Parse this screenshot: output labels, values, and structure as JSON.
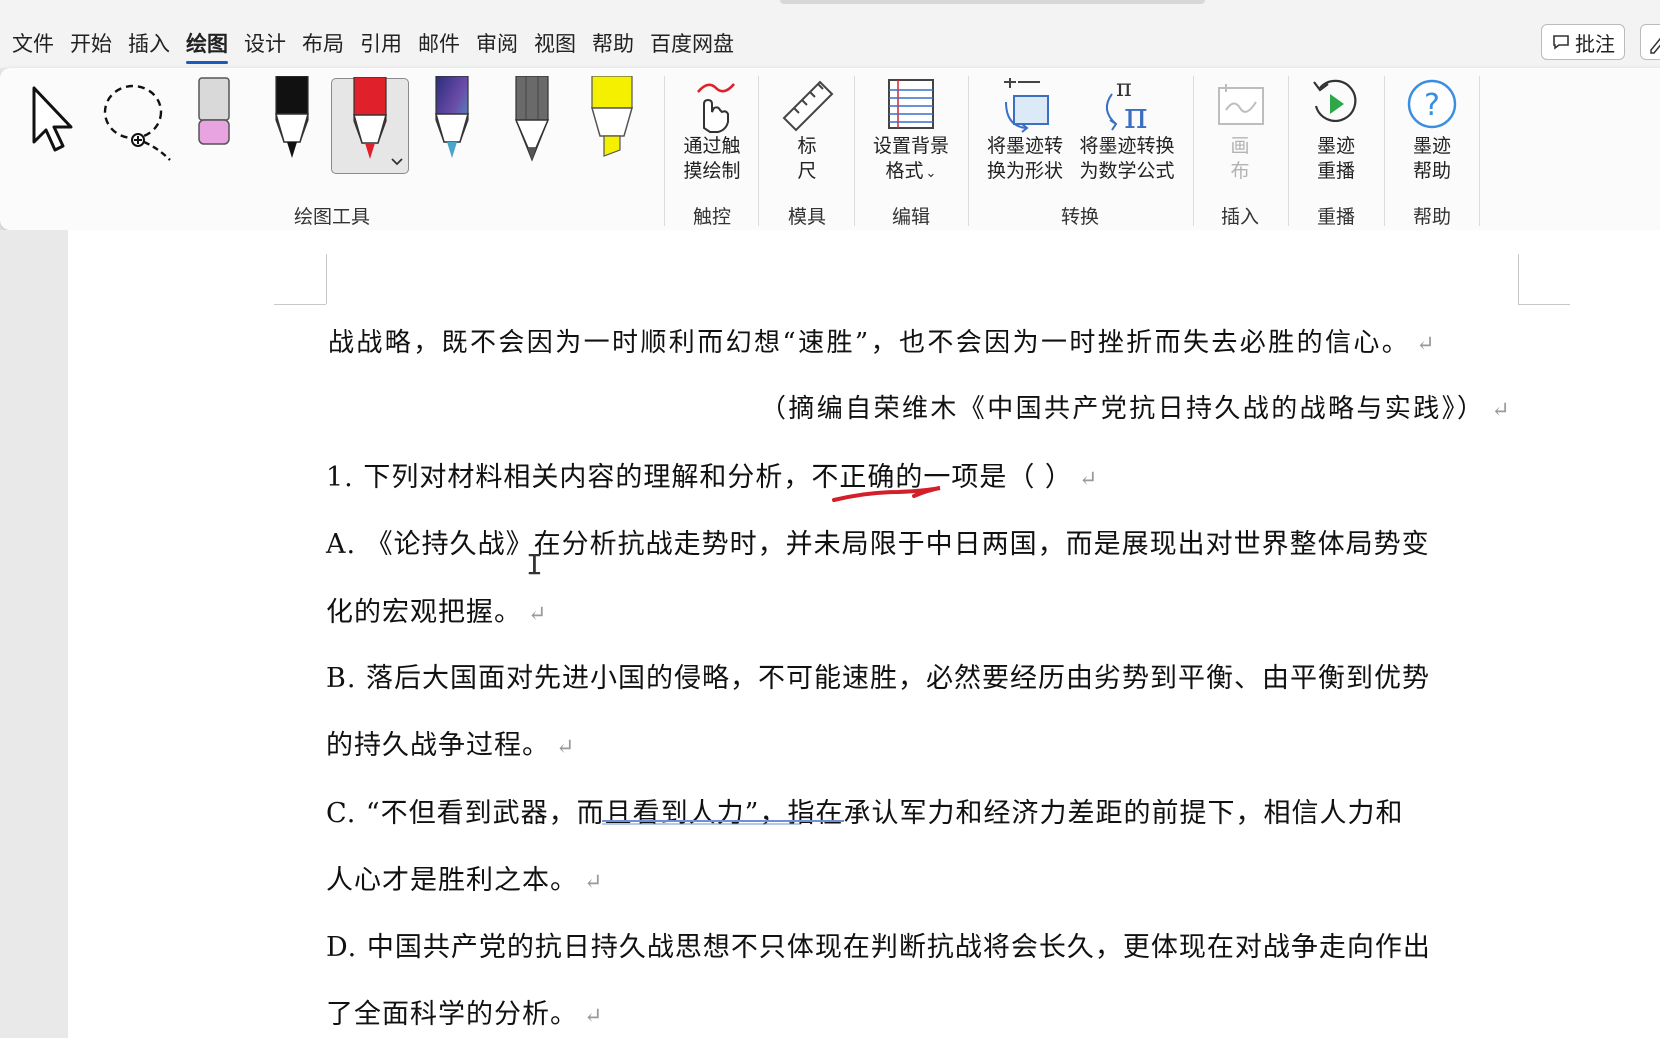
{
  "tabs": [
    {
      "label": "文件",
      "active": false
    },
    {
      "label": "开始",
      "active": false
    },
    {
      "label": "插入",
      "active": false
    },
    {
      "label": "绘图",
      "active": true
    },
    {
      "label": "设计",
      "active": false
    },
    {
      "label": "布局",
      "active": false
    },
    {
      "label": "引用",
      "active": false
    },
    {
      "label": "邮件",
      "active": false
    },
    {
      "label": "审阅",
      "active": false
    },
    {
      "label": "视图",
      "active": false
    },
    {
      "label": "帮助",
      "active": false
    },
    {
      "label": "百度网盘",
      "active": false
    }
  ],
  "comment_button": {
    "label": "批注",
    "icon": "comment-icon"
  },
  "ribbon": {
    "groups": {
      "drawing_tools": "绘图工具",
      "touch": "触控",
      "stencils": "模具",
      "edit": "编辑",
      "convert": "转换",
      "insert": "插入",
      "replay": "重播",
      "help": "帮助"
    },
    "buttons": {
      "draw_with_touch": [
        "通过触",
        "摸绘制"
      ],
      "ruler": [
        "标",
        "尺"
      ],
      "background_format": [
        "设置背景",
        "格式"
      ],
      "ink_to_shape": [
        "将墨迹转",
        "换为形状"
      ],
      "ink_to_math": [
        "将墨迹转换",
        "为数学公式"
      ],
      "canvas": [
        "画",
        "布"
      ],
      "ink_replay": [
        "墨迹",
        "重播"
      ],
      "ink_help": [
        "墨迹",
        "帮助"
      ]
    },
    "pen_colors": {
      "eraser": "#e8a4e0",
      "black_pen": "#111111",
      "red_pen": "#e0202a",
      "galaxy_pen": "#4aa5c8",
      "pencil": "#555555",
      "highlighter": "#f5f000"
    }
  },
  "document": {
    "lines": [
      "战战略，既不会因为一时顺利而幻想“速胜”，也不会因为一时挫折而失去必胜的信心。",
      "（摘编自荣维木《中国共产党抗日持久战的战略与实践》）",
      "1. 下列对材料相关内容的理解和分析，不正确的一项是（     ）",
      "A. 《论持久战》在分析抗战走势时，并未局限于中日两国，而是展现出对世界整体局势变",
      "化的宏观把握。",
      "B. 落后大国面对先进小国的侵略，不可能速胜，必然要经历由劣势到平衡、由平衡到优势",
      "的持久战争过程。",
      "C. “不但看到武器，而且看到人力”，指在承认军力和经济力差距的前提下，相信人力和",
      "人心才是胜利之本。",
      "D. 中国共产党的抗日持久战思想不只体现在判断抗战将会长久，更体现在对战争走向作出",
      "了全面科学的分析。"
    ],
    "paragraph_mark": "↵",
    "ink_color": "#d21f2a",
    "underline_color": "#6f8fd6"
  }
}
